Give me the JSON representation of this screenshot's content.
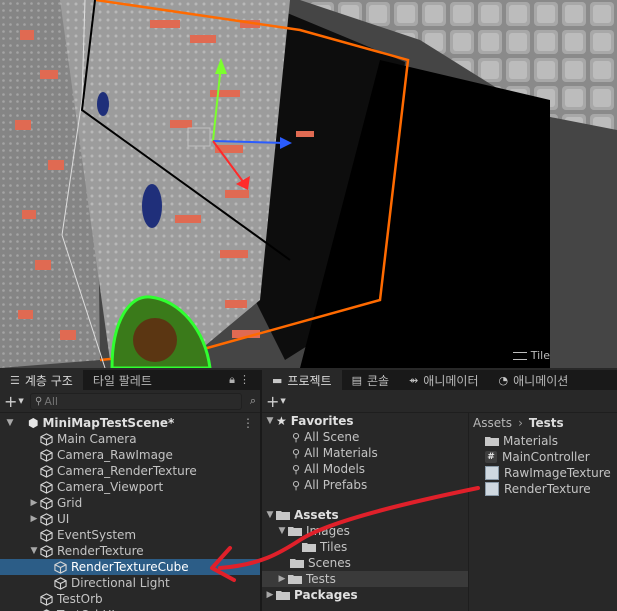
{
  "scene_view": {
    "tile_label": "Tile"
  },
  "hierarchy": {
    "tabs": [
      {
        "label": "계층 구조",
        "icon": "list-icon"
      },
      {
        "label": "타일 팔레트",
        "icon": ""
      }
    ],
    "search_placeholder": "All",
    "scene": "MiniMapTestScene*",
    "items": [
      {
        "label": "Main Camera",
        "indent": 2,
        "expand": ""
      },
      {
        "label": "Camera_RawImage",
        "indent": 2,
        "expand": ""
      },
      {
        "label": "Camera_RenderTexture",
        "indent": 2,
        "expand": ""
      },
      {
        "label": "Camera_Viewport",
        "indent": 2,
        "expand": ""
      },
      {
        "label": "Grid",
        "indent": 2,
        "expand": "▶"
      },
      {
        "label": "UI",
        "indent": 2,
        "expand": "▶"
      },
      {
        "label": "EventSystem",
        "indent": 2,
        "expand": ""
      },
      {
        "label": "RenderTexture",
        "indent": 2,
        "expand": "▼"
      },
      {
        "label": "RenderTextureCube",
        "indent": 3,
        "expand": "",
        "selected": true
      },
      {
        "label": "Directional Light",
        "indent": 3,
        "expand": ""
      },
      {
        "label": "TestOrb",
        "indent": 2,
        "expand": ""
      },
      {
        "label": "TestOrbUI",
        "indent": 2,
        "expand": ""
      }
    ]
  },
  "project": {
    "tabs": [
      {
        "label": "프로젝트",
        "icon": "folder-icon"
      },
      {
        "label": "콘솔",
        "icon": "console-icon"
      },
      {
        "label": "애니메이터",
        "icon": "animator-icon"
      },
      {
        "label": "애니메이션",
        "icon": "clock-icon"
      }
    ],
    "favorites": {
      "label": "Favorites",
      "items": [
        "All Scene",
        "All Materials",
        "All Models",
        "All Prefabs"
      ]
    },
    "assets": {
      "label": "Assets",
      "images": "Images",
      "tiles": "Tiles",
      "scenes": "Scenes",
      "tests": "Tests"
    },
    "packages": "Packages",
    "breadcrumb": {
      "root": "Assets",
      "current": "Tests"
    },
    "files": [
      {
        "label": "Materials",
        "icon": "folder-icon"
      },
      {
        "label": "MainController",
        "icon": "script-icon"
      },
      {
        "label": "RawImageTexture",
        "icon": "render-texture-icon"
      },
      {
        "label": "RenderTexture",
        "icon": "render-texture-icon"
      }
    ]
  },
  "colors": {
    "selection": "#2c5d87",
    "annotation": "#e0202a",
    "outline_orange": "#ff6a00"
  }
}
